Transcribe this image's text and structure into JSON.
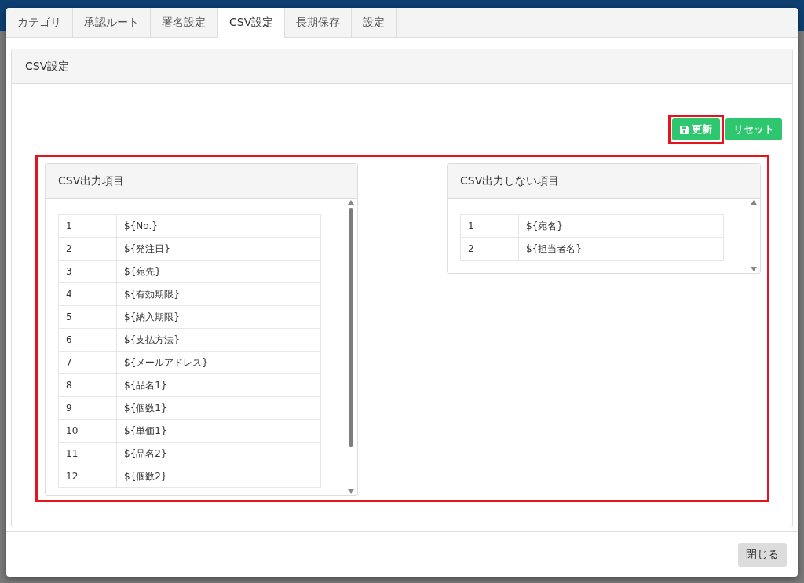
{
  "tabs": [
    {
      "label": "カテゴリ",
      "selected": false
    },
    {
      "label": "承認ルート",
      "selected": false
    },
    {
      "label": "署名設定",
      "selected": false
    },
    {
      "label": "CSV設定",
      "selected": true
    },
    {
      "label": "長期保存",
      "selected": false
    },
    {
      "label": "設定",
      "selected": false
    }
  ],
  "panel": {
    "title": "CSV設定",
    "buttons": [
      {
        "label": "更新",
        "kind": "save",
        "highlighted": true
      },
      {
        "label": "リセット",
        "kind": "plain",
        "highlighted": false
      }
    ],
    "highlighted": true,
    "lists": [
      {
        "title": "CSV出力項目",
        "rows": [
          {
            "no": "1",
            "field": "${No.}"
          },
          {
            "no": "2",
            "field": "${発注日}"
          },
          {
            "no": "3",
            "field": "${宛先}"
          },
          {
            "no": "4",
            "field": "${有効期限}"
          },
          {
            "no": "5",
            "field": "${納入期限}"
          },
          {
            "no": "6",
            "field": "${支払方法}"
          },
          {
            "no": "7",
            "field": "${メールアドレス}"
          },
          {
            "no": "8",
            "field": "${品名1}"
          },
          {
            "no": "9",
            "field": "${個数1}"
          },
          {
            "no": "10",
            "field": "${単価1}"
          },
          {
            "no": "11",
            "field": "${品名2}"
          },
          {
            "no": "12",
            "field": "${個数2}"
          }
        ]
      },
      {
        "title": "CSV出力しない項目",
        "rows": [
          {
            "no": "1",
            "field": "${宛名}"
          },
          {
            "no": "2",
            "field": "${担当者名}"
          }
        ]
      }
    ]
  },
  "footer": {
    "close_button": "閉じる"
  }
}
